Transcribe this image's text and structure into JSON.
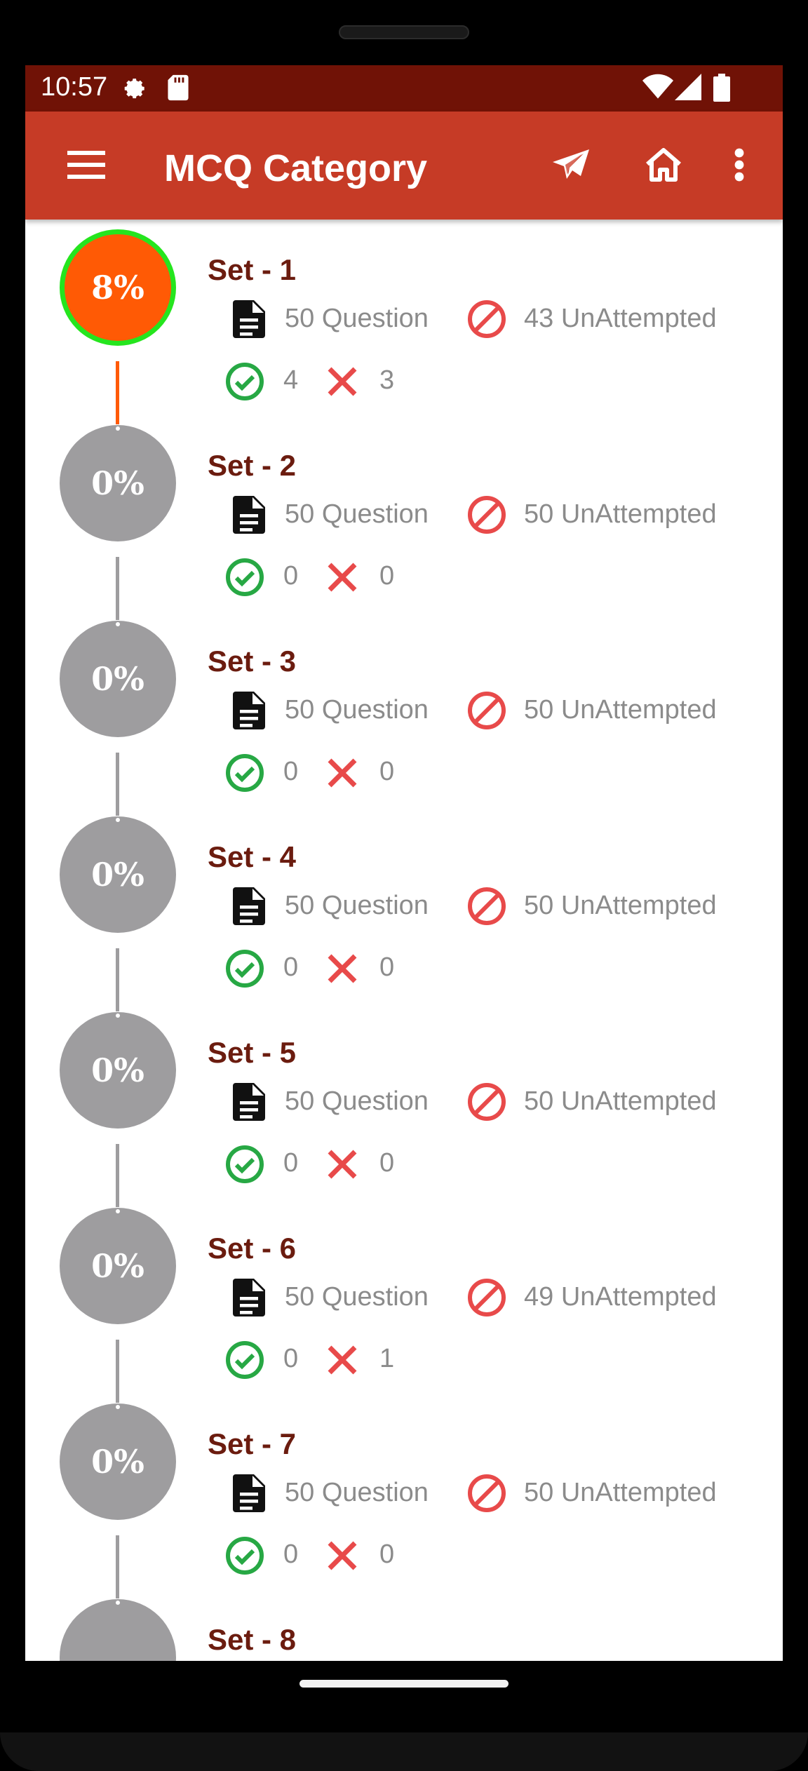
{
  "status_bar": {
    "time": "10:57",
    "icons": [
      "settings-icon",
      "sd-card-icon",
      "wifi-icon",
      "signal-icon",
      "battery-icon"
    ]
  },
  "app_bar": {
    "title": "MCQ Category",
    "icons": [
      "menu-icon",
      "send-icon",
      "home-icon",
      "more-vert-icon"
    ]
  },
  "colors": {
    "status_bar": "#701206",
    "app_bar": "#c63b26",
    "active_circle": "#ff5a05",
    "active_ring": "#25e51e",
    "inactive_circle": "#9e9d9f",
    "title_text": "#6b1c0f",
    "correct": "#27a844",
    "wrong": "#e84a4a"
  },
  "sets": [
    {
      "title": "Set - 1",
      "percent": "8%",
      "questions": "50 Question",
      "unattempted": "43 UnAttempted",
      "correct": "4",
      "wrong": "3",
      "active": true
    },
    {
      "title": "Set - 2",
      "percent": "0%",
      "questions": "50 Question",
      "unattempted": "50 UnAttempted",
      "correct": "0",
      "wrong": "0",
      "active": false
    },
    {
      "title": "Set - 3",
      "percent": "0%",
      "questions": "50 Question",
      "unattempted": "50 UnAttempted",
      "correct": "0",
      "wrong": "0",
      "active": false
    },
    {
      "title": "Set - 4",
      "percent": "0%",
      "questions": "50 Question",
      "unattempted": "50 UnAttempted",
      "correct": "0",
      "wrong": "0",
      "active": false
    },
    {
      "title": "Set - 5",
      "percent": "0%",
      "questions": "50 Question",
      "unattempted": "50 UnAttempted",
      "correct": "0",
      "wrong": "0",
      "active": false
    },
    {
      "title": "Set - 6",
      "percent": "0%",
      "questions": "50 Question",
      "unattempted": "49 UnAttempted",
      "correct": "0",
      "wrong": "1",
      "active": false
    },
    {
      "title": "Set - 7",
      "percent": "0%",
      "questions": "50 Question",
      "unattempted": "50 UnAttempted",
      "correct": "0",
      "wrong": "0",
      "active": false
    },
    {
      "title": "Set - 8",
      "percent": "",
      "questions": "",
      "unattempted": "",
      "correct": "",
      "wrong": "",
      "active": false
    }
  ]
}
